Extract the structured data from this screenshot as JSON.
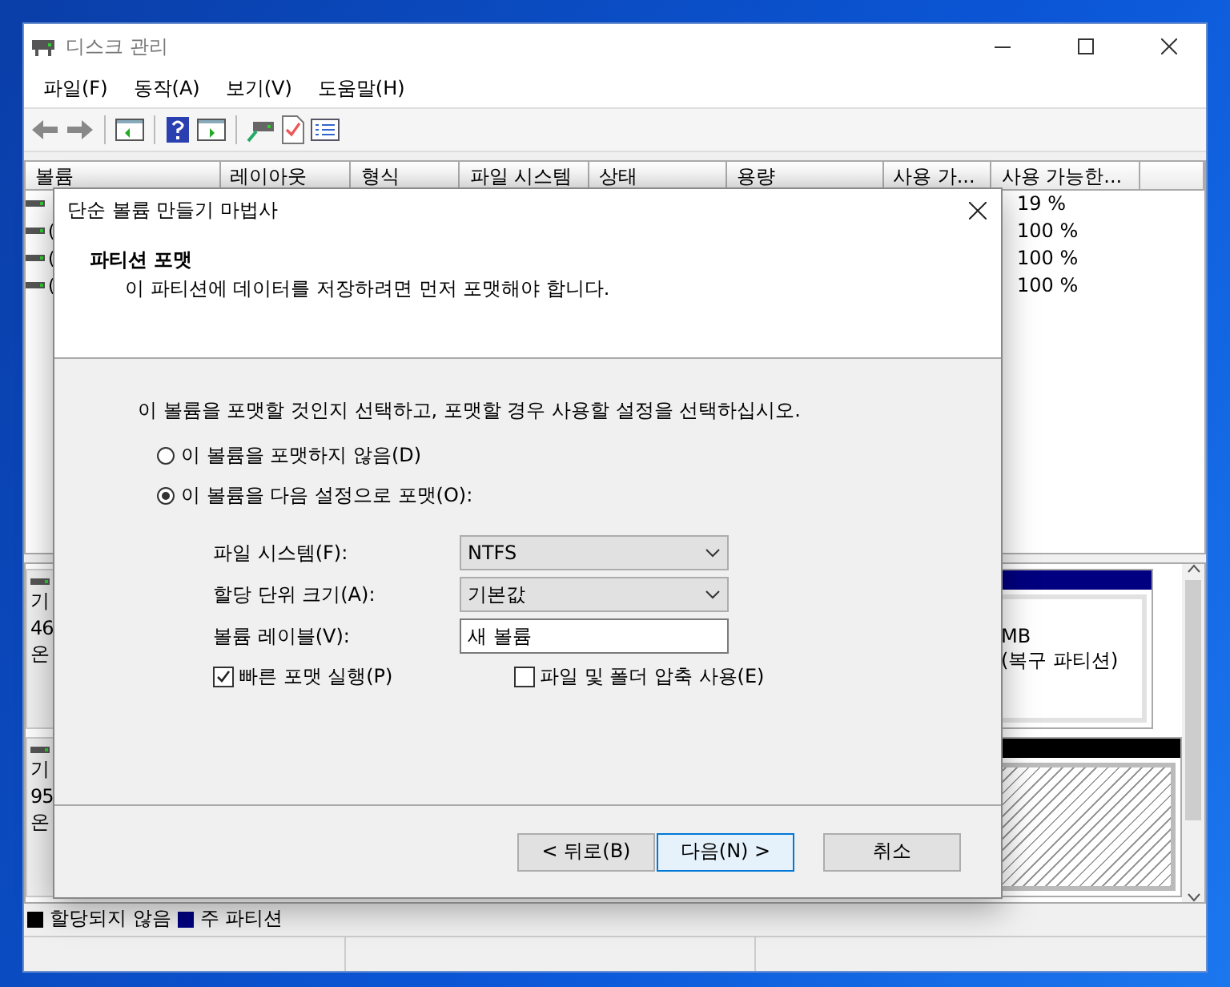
{
  "window": {
    "title": "디스크 관리"
  },
  "menu": [
    "파일(F)",
    "동작(A)",
    "보기(V)",
    "도움말(H)"
  ],
  "volume_table": {
    "columns": [
      "볼륨",
      "레이아웃",
      "형식",
      "파일 시스템",
      "상태",
      "용량",
      "사용 가...",
      "사용 가능한..."
    ],
    "rows": [
      {
        "free_percent": "19 %"
      },
      {
        "volume": "(",
        "free_percent": "100 %"
      },
      {
        "volume": "(",
        "free_percent": "100 %"
      },
      {
        "volume": "(",
        "free_percent": "100 %"
      }
    ]
  },
  "disks": [
    {
      "label_lines": [
        "기",
        "46",
        "온"
      ],
      "partition": {
        "kind": "primary",
        "lines": [
          "MB",
          "(복구 파티션)"
        ]
      }
    },
    {
      "label_lines": [
        "기",
        "95",
        "온"
      ],
      "partition": {
        "kind": "unallocated"
      }
    }
  ],
  "legend": [
    {
      "label": "할당되지 않음",
      "color": "#000000"
    },
    {
      "label": "주 파티션",
      "color": "#000080"
    }
  ],
  "dialog": {
    "title": "단순 볼륨 만들기 마법사",
    "heading": "파티션 포맷",
    "subheading": "이 파티션에 데이터를 저장하려면 먼저 포맷해야 합니다.",
    "instruction": "이 볼륨을 포맷할 것인지 선택하고, 포맷할 경우 사용할 설정을 선택하십시오.",
    "options": [
      {
        "label": "이 볼륨을 포맷하지 않음(D)",
        "selected": false
      },
      {
        "label": "이 볼륨을 다음 설정으로 포맷(O):",
        "selected": true
      }
    ],
    "fields": [
      {
        "kind": "select",
        "label": "파일 시스템(F):",
        "value": "NTFS"
      },
      {
        "kind": "select",
        "label": "할당 단위 크기(A):",
        "value": "기본값"
      },
      {
        "kind": "text",
        "label": "볼륨 레이블(V):",
        "value": "새 볼륨"
      }
    ],
    "checkboxes": [
      {
        "label": "빠른 포맷 실행(P)",
        "checked": true
      },
      {
        "label": "파일 및 폴더 압축 사용(E)",
        "checked": false
      }
    ],
    "buttons": [
      {
        "label": "< 뒤로(B)",
        "default": false
      },
      {
        "label": "다음(N) >",
        "default": true
      },
      {
        "label": "취소",
        "default": false
      }
    ]
  }
}
